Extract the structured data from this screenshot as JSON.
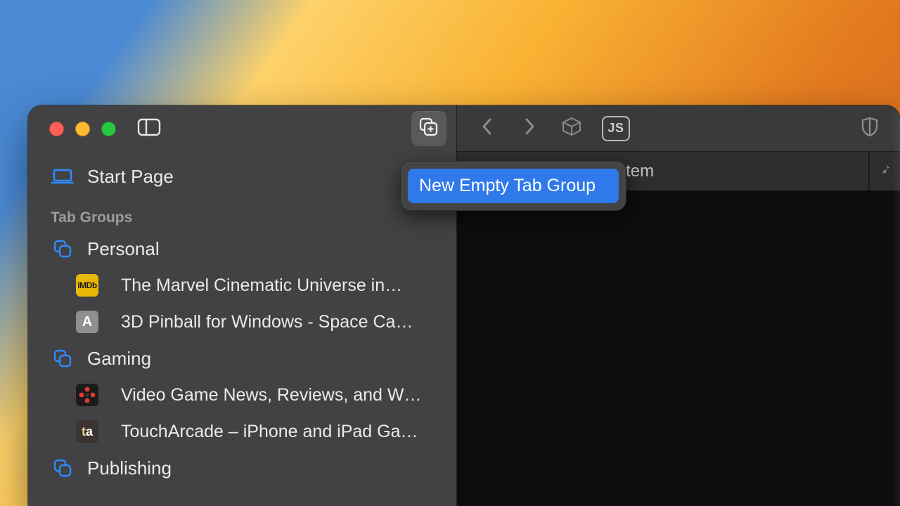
{
  "popover": {
    "item_label": "New Empty Tab Group"
  },
  "sidebar": {
    "start_label": "Start Page",
    "section_title": "Tab Groups",
    "groups": [
      {
        "name": "Personal",
        "tabs": [
          {
            "title": "The Marvel Cinematic Universe in…",
            "favicon_text": "IMDb"
          },
          {
            "title": "3D Pinball for Windows - Space Ca…",
            "favicon_text": "A"
          }
        ]
      },
      {
        "name": "Gaming",
        "tabs": [
          {
            "title": "Video Game News, Reviews, and W…"
          },
          {
            "title": "TouchArcade – iPhone and iPad Ga…",
            "favicon_text": "ta"
          }
        ]
      },
      {
        "name": "Publishing",
        "tabs": []
      }
    ]
  },
  "toolbar": {},
  "content": {
    "active_tab_label": "sider Publishing System"
  }
}
